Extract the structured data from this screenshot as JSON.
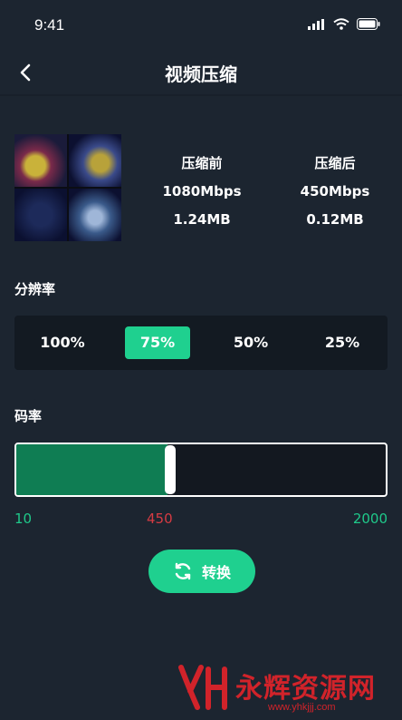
{
  "status_bar": {
    "time": "9:41"
  },
  "header": {
    "title": "视频压缩",
    "back_icon": "chevron-left-icon"
  },
  "compare": {
    "before": {
      "label": "压缩前",
      "bitrate": "1080Mbps",
      "size": "1.24MB"
    },
    "after": {
      "label": "压缩后",
      "bitrate": "450Mbps",
      "size": "0.12MB"
    }
  },
  "resolution": {
    "label": "分辨率",
    "options": [
      "100%",
      "75%",
      "50%",
      "25%"
    ],
    "selected": "75%"
  },
  "bitrate": {
    "label": "码率",
    "min": "10",
    "current": "450",
    "max": "2000",
    "level_fraction": 0.41
  },
  "convert_button": {
    "label": "转换",
    "icon": "refresh-icon"
  },
  "watermark": {
    "text": "永辉资源网",
    "url": "www.yhkjjj.com"
  },
  "colors": {
    "accent": "#1fd08f",
    "background": "#1c2530",
    "panel": "#131a22",
    "current_value": "#d63b43"
  }
}
